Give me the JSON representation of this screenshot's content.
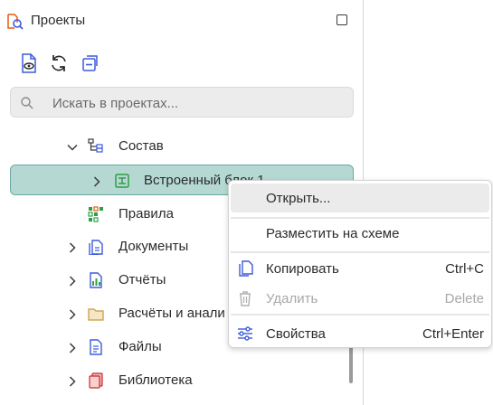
{
  "panel": {
    "title": "Проекты",
    "toolbar": [
      {
        "icon": "document-eye-icon",
        "name": "show-document-button"
      },
      {
        "icon": "refresh-icon",
        "name": "refresh-button"
      },
      {
        "icon": "collapse-all-icon",
        "name": "collapse-all-button"
      }
    ]
  },
  "search": {
    "placeholder": "Искать в проектах..."
  },
  "tree": [
    {
      "label": "Состав",
      "icon": "structure-icon",
      "expanded": true
    },
    {
      "label": "Встроенный блок 1",
      "icon": "embedded-block-icon",
      "expanded": false,
      "selected": true
    },
    {
      "label": "Правила",
      "icon": "rules-icon"
    },
    {
      "label": "Документы",
      "icon": "documents-icon",
      "expanded": false
    },
    {
      "label": "Отчёты",
      "icon": "reports-icon",
      "expanded": false
    },
    {
      "label": "Расчёты и анали",
      "icon": "folder-icon",
      "expanded": false
    },
    {
      "label": "Файлы",
      "icon": "files-icon",
      "expanded": false
    },
    {
      "label": "Библиотека",
      "icon": "library-icon",
      "expanded": false
    }
  ],
  "context_menu": {
    "items": [
      {
        "label": "Открыть...",
        "shortcut": "",
        "enabled": true,
        "hover": true
      },
      {
        "label": "Разместить на схеме",
        "shortcut": "",
        "enabled": true
      },
      {
        "label": "Копировать",
        "shortcut": "Ctrl+C",
        "enabled": true,
        "icon": "copy-icon"
      },
      {
        "label": "Удалить",
        "shortcut": "Delete",
        "enabled": false,
        "icon": "trash-icon"
      },
      {
        "label": "Свойства",
        "shortcut": "Ctrl+Enter",
        "enabled": true,
        "icon": "settings-sliders-icon"
      }
    ]
  },
  "colors": {
    "selection_bg": "#b5d9d2",
    "selection_border": "#6aa9a0",
    "accent_blue": "#3b5bdb",
    "accent_green": "#2f9e44",
    "accent_orange": "#e8590c"
  }
}
